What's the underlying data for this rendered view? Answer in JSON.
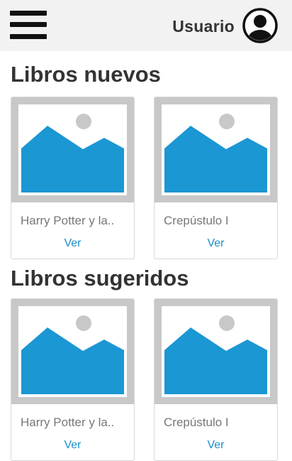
{
  "header": {
    "menu_icon": "hamburger-menu-icon",
    "user_label": "Usuario",
    "avatar_icon": "user-avatar-icon"
  },
  "sections": [
    {
      "title": "Libros nuevos",
      "books": [
        {
          "title": "Harry Potter y la..",
          "action": "Ver",
          "image_icon": "image-placeholder-icon"
        },
        {
          "title": "Crepústulo I",
          "action": "Ver",
          "image_icon": "image-placeholder-icon"
        }
      ]
    },
    {
      "title": "Libros sugeridos",
      "books": [
        {
          "title": "Harry Potter y la..",
          "action": "Ver",
          "image_icon": "image-placeholder-icon"
        },
        {
          "title": "Crepústulo I",
          "action": "Ver",
          "image_icon": "image-placeholder-icon"
        }
      ]
    }
  ],
  "colors": {
    "header_bg": "#f2f2f2",
    "accent_link": "#1a8fc8",
    "placeholder_blue": "#1b97d4",
    "placeholder_gray": "#c8c8c8"
  }
}
